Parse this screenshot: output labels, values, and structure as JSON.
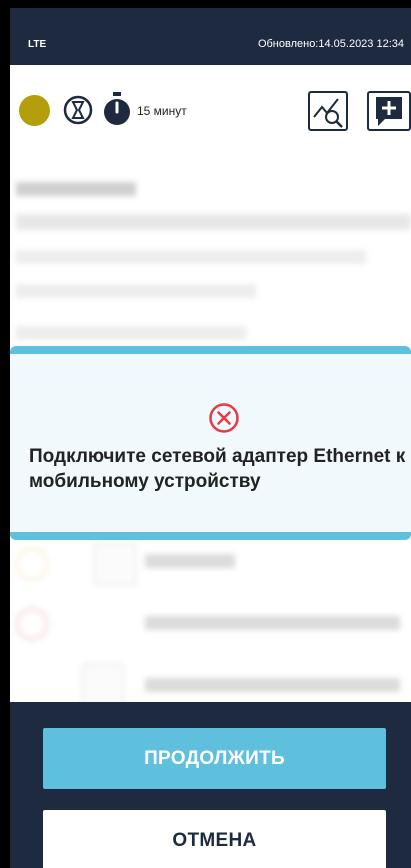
{
  "status_bar": {
    "carrier": "LTE",
    "updated": "Обновлено:14.05.2023 12:34"
  },
  "toolbar": {
    "timer_label": "15 минут",
    "status_color": "#b59e0c",
    "icons": [
      "status-dot",
      "hourglass-icon",
      "stopwatch-icon",
      "chart-search-icon",
      "add-note-icon"
    ]
  },
  "dialog": {
    "icon": "error-circle-icon",
    "message": "Подключите сетевой адаптер Ethernet к мобильному устройству"
  },
  "footer": {
    "continue_label": "ПРОДОЛЖИТЬ",
    "cancel_label": "ОТМЕНА"
  },
  "colors": {
    "navy": "#1d2a3f",
    "accent": "#5ec0dc",
    "error": "#e53946"
  }
}
